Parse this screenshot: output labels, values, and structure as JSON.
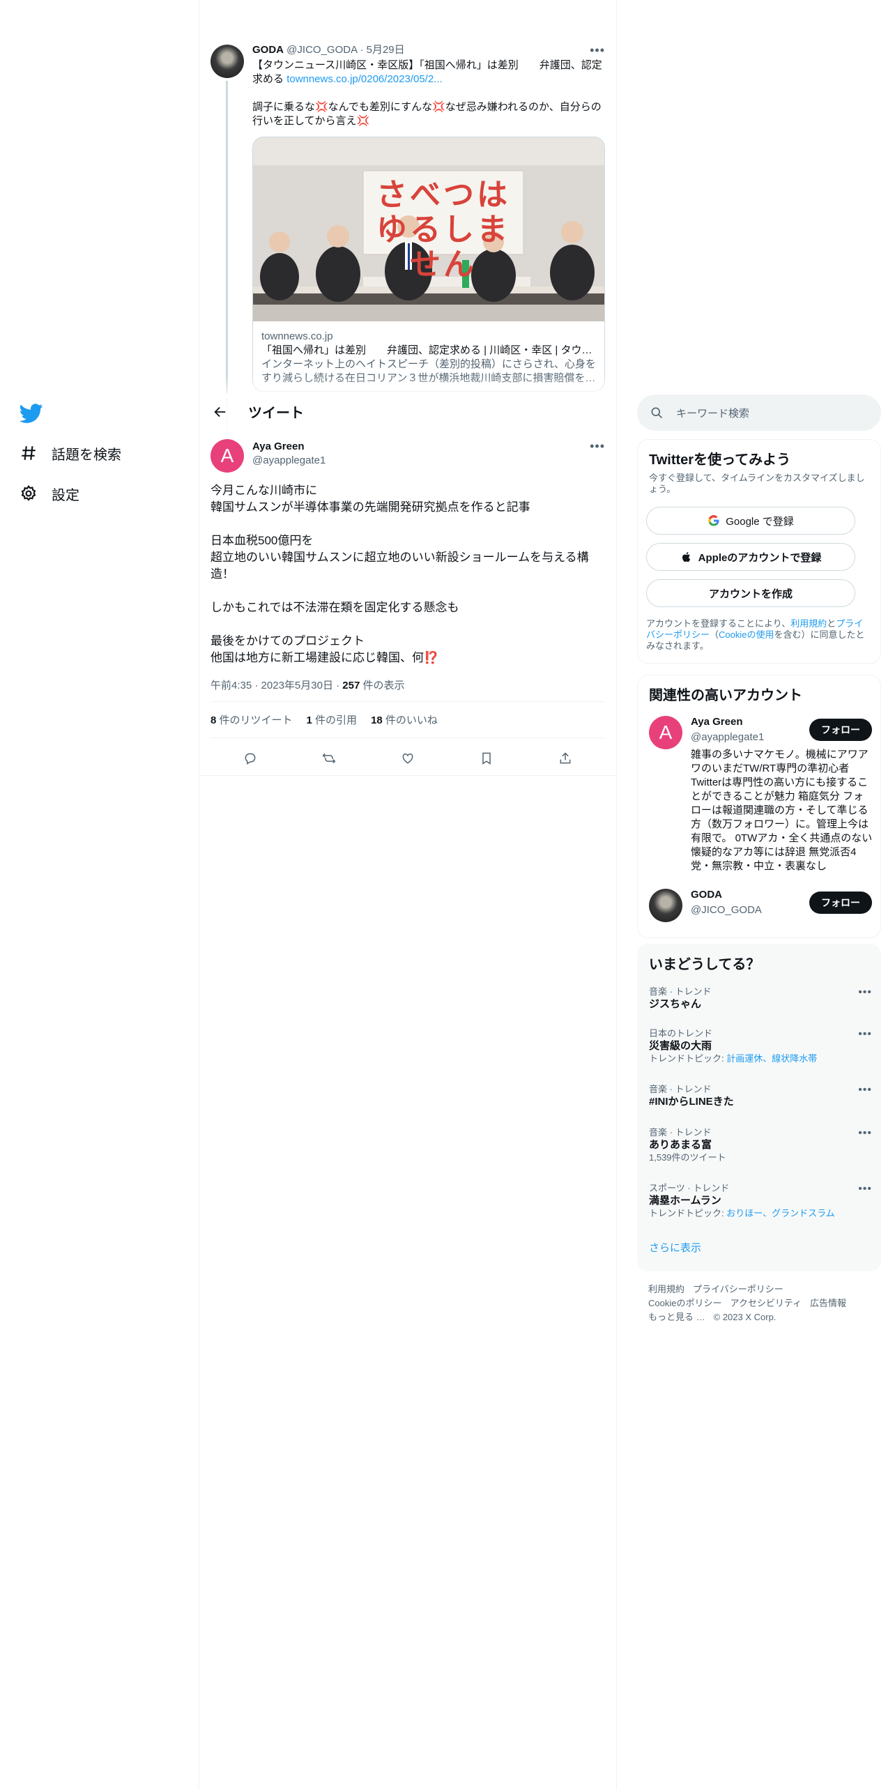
{
  "nav": {
    "explore_label": "話題を検索",
    "settings_label": "設定"
  },
  "quoted_tweet": {
    "name": "GODA",
    "handle": "@JICO_GODA",
    "sep": "·",
    "date": "5月29日",
    "text_line1": "【タウンニュース川崎区・幸区版】「祖国へ帰れ」は差別　　弁護団、認定求める",
    "link": "townnews.co.jp/0206/2023/05/2...",
    "text_line2": "調子に乗るな💢なんでも差別にすんな💢なぜ忌み嫌われるのか、自分らの行いを正してから言え💢",
    "card": {
      "banner_text": "さべつは ゆるしません",
      "domain": "townnews.co.jp",
      "title": "「祖国へ帰れ」は差別　　弁護団、認定求める | 川崎区・幸区 | タウ…",
      "description": "インターネット上のヘイトスピーチ（差別的投稿）にさらされ、心身をすり減らし続ける在日コリアン３世が横浜地裁川崎支部に損害賠償を…"
    }
  },
  "header": {
    "title": "ツイート"
  },
  "main_tweet": {
    "avatar_letter": "A",
    "name": "Aya Green",
    "handle": "@ayapplegate1",
    "text": "今月こんな川崎市に\n韓国サムスンが半導体事業の先端開発研究拠点を作ると記事\n\n日本血税500億円を\n超立地のいい韓国サムスンに超立地のいい新設ショールームを与える構造！\n\nしかもこれでは不法滞在類を固定化する懸念も\n\n最後をかけてのプロジェクト\n他国は地方に新工場建設に応じ韓国、何⁉️",
    "time": "午前4:35",
    "date": "2023年5月30日",
    "sep": "·",
    "views_count": "257",
    "views_label": "件の表示",
    "retweets_count": "8",
    "retweets_label": "件のリツイート",
    "quotes_count": "1",
    "quotes_label": "件の引用",
    "likes_count": "18",
    "likes_label": "件のいいね"
  },
  "search": {
    "placeholder": "キーワード検索"
  },
  "signup": {
    "title": "Twitterを使ってみよう",
    "subtitle": "今すぐ登録して、タイムラインをカスタマイズしましょう。",
    "google_label": "Google で登録",
    "apple_label": "Appleのアカウントで登録",
    "create_label": "アカウントを作成",
    "legal_pre": "アカウントを登録することにより、",
    "legal_terms": "利用規約",
    "legal_and": "と",
    "legal_privacy": "プライバシーポリシー",
    "legal_paren_open": "（",
    "legal_cookie": "Cookieの使用",
    "legal_post": "を含む）に同意したとみなされます。"
  },
  "relevant": {
    "title": "関連性の高いアカウント",
    "accounts": [
      {
        "avatar_letter": "A",
        "name": "Aya Green",
        "handle": "@ayapplegate1",
        "follow_label": "フォロー",
        "bio": "雑事の多いナマケモノ。機械にアワアワのいまだTW/RT専門の準初心者 Twitterは専門性の高い方にも接することができることが魅力 箱庭気分 フォローは報道関連職の方・そして準じる方（数万フォロワー）に。管理上今は有限で。 0TWアカ・全く共通点のない懐疑的なアカ等には辞退 無党派否4党・無宗教・中立・表裏なし"
      },
      {
        "name": "GODA",
        "handle": "@JICO_GODA",
        "follow_label": "フォロー"
      }
    ]
  },
  "trends": {
    "title": "いまどうしてる？",
    "items": [
      {
        "category": "音楽 · トレンド",
        "name": "ジスちゃん",
        "topic_label": "",
        "topics": ""
      },
      {
        "category": "日本のトレンド",
        "name": "災害級の大雨",
        "topic_label": "トレンドトピック: ",
        "topics": "計画運休、線状降水帯"
      },
      {
        "category": "音楽 · トレンド",
        "name": "#INIからLINEきた",
        "topic_label": "",
        "topics": ""
      },
      {
        "category": "音楽 · トレンド",
        "name": "ありあまる富",
        "topic_label": "1,539件のツイート",
        "topics": ""
      },
      {
        "category": "スポーツ · トレンド",
        "name": "満塁ホームラン",
        "topic_label": "トレンドトピック: ",
        "topics": "おりほー、グランドスラム"
      }
    ],
    "show_more": "さらに表示"
  },
  "footer": {
    "terms": "利用規約",
    "privacy": "プライバシーポリシー",
    "cookie": "Cookieのポリシー",
    "accessibility": "アクセシビリティ",
    "ads": "広告情報",
    "more": "もっと見る …",
    "copyright": "© 2023 X Corp."
  },
  "colors": {
    "accent": "#1d9bf0",
    "avatar_pink": "#e8407a",
    "text": "#0f1419",
    "muted": "#536471"
  }
}
